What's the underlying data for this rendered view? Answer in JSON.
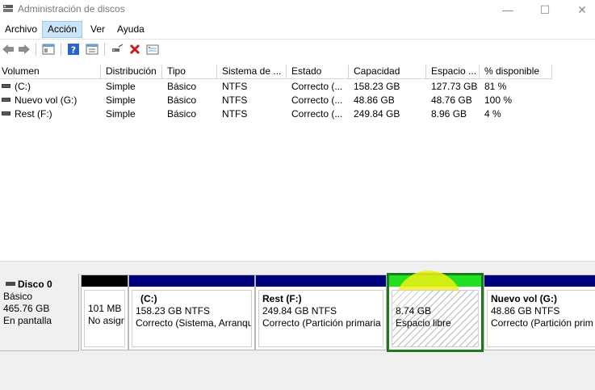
{
  "window": {
    "title": "Administración de discos",
    "minimize": "—",
    "maximize": "☐",
    "close": "✕"
  },
  "menu": [
    "Archivo",
    "Acción",
    "Ver",
    "Ayuda"
  ],
  "toolbar": {
    "icons": [
      "back-icon",
      "forward-icon",
      "console-tree-icon",
      "help-icon",
      "properties-icon",
      "connect-icon",
      "delete-icon",
      "list-icon"
    ]
  },
  "volume_list": {
    "columns": [
      "Volumen",
      "Distribución",
      "Tipo",
      "Sistema de ...",
      "Estado",
      "Capacidad",
      "Espacio ...",
      "% disponible"
    ],
    "rows": [
      [
        "(C:)",
        "Simple",
        "Básico",
        "NTFS",
        "Correcto (...",
        "158.23 GB",
        "127.73 GB",
        "81 %"
      ],
      [
        "Nuevo vol (G:)",
        "Simple",
        "Básico",
        "NTFS",
        "Correcto (...",
        "48.86 GB",
        "48.76 GB",
        "100 %"
      ],
      [
        "Rest (F:)",
        "Simple",
        "Básico",
        "NTFS",
        "Correcto (...",
        "249.84 GB",
        "8.96 GB",
        "4 %"
      ]
    ]
  },
  "disk": {
    "name": "Disco 0",
    "type": "Básico",
    "size": "465.76 GB",
    "status": "En pantalla",
    "partitions": [
      {
        "name": "",
        "size": "101 MB",
        "status": "No asignado",
        "bar_color": "#000000"
      },
      {
        "name": "(C:)",
        "size": "158.23 GB NTFS",
        "status": "Correcto (Sistema, Arranque",
        "bar_color": "#00007b"
      },
      {
        "name": "Rest  (F:)",
        "size": "249.84 GB NTFS",
        "status": "Correcto (Partición primaria",
        "bar_color": "#00007b"
      },
      {
        "name": "",
        "size": "8.74 GB",
        "status": "Espacio libre",
        "bar_color": "#22e022"
      },
      {
        "name": "Nuevo vol  (G:)",
        "size": "48.86 GB NTFS",
        "status": "Correcto (Partición prim",
        "bar_color": "#00007b"
      }
    ]
  },
  "colors": {
    "primary_partition": "#00007b",
    "unallocated": "#000000",
    "free_space": "#22e022",
    "selection_border": "#1e7a1e",
    "highlight_marker": "#f0f014"
  }
}
